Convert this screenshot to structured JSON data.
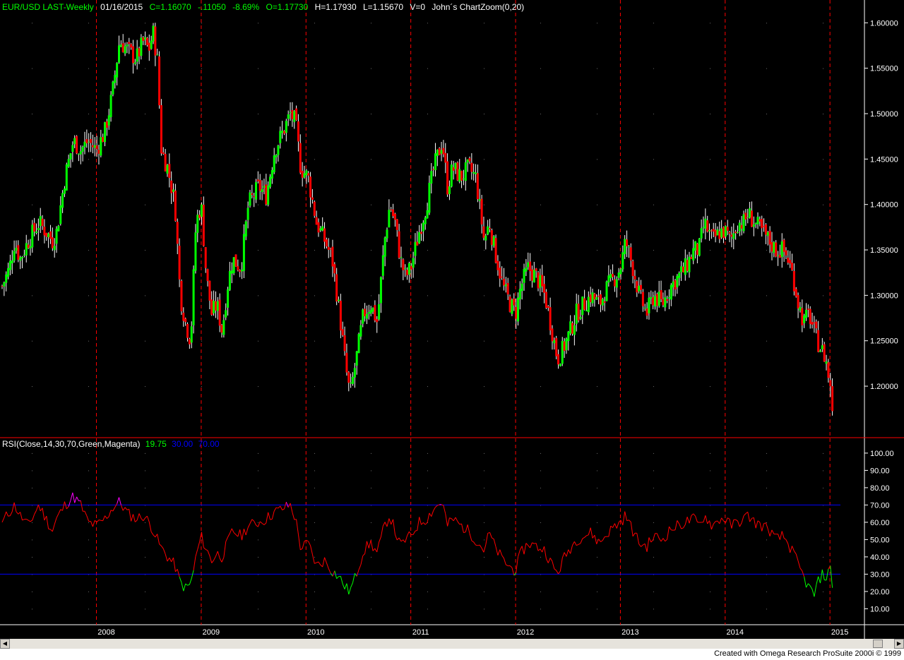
{
  "header": {
    "symbol": "EUR/USD LAST-Weekly",
    "date": "01/16/2015",
    "close": "C=1.16070",
    "change": "-.11050",
    "pct": "-8.69%",
    "open": "O=1.17730",
    "high": "H=1.17930",
    "low": "L=1.15670",
    "volume": "V=0",
    "study": "John´s ChartZoom(0,20)"
  },
  "rsi_header": {
    "label": "RSI(Close,14,30,70,Green,Magenta)",
    "value": "19.75",
    "low": "30.00",
    "high": "70.00"
  },
  "footer": {
    "text": "Created with Omega Research ProSuite 2000i © 1999"
  },
  "colors": {
    "up": "#00ff00",
    "down": "#ff0000",
    "text_green": "#00ff00",
    "text_white": "#ffffff",
    "rsi_blue": "#0000ff",
    "separator": "#ff0000",
    "rsi_normal": "#ff0000",
    "rsi_oversold": "#00ff00",
    "rsi_overbought": "#ff00ff"
  },
  "chart_data": [
    {
      "type": "candlestick",
      "title": "EUR/USD LAST-Weekly",
      "x_labels": [
        "2008",
        "2009",
        "2010",
        "2011",
        "2012",
        "2013",
        "2014",
        "2015"
      ],
      "x_label_dates": [
        2008.0,
        2009.0,
        2010.0,
        2011.0,
        2012.0,
        2013.0,
        2014.0,
        2015.0
      ],
      "x_range": [
        2007.1,
        2015.1
      ],
      "y_ticks": [
        "1.60000",
        "1.55000",
        "1.50000",
        "1.45000",
        "1.40000",
        "1.35000",
        "1.30000",
        "1.25000",
        "1.20000"
      ],
      "ylim": [
        1.148,
        1.608
      ],
      "close_path": [
        [
          2007.1,
          1.31
        ],
        [
          2007.17,
          1.33
        ],
        [
          2007.22,
          1.36
        ],
        [
          2007.27,
          1.34
        ],
        [
          2007.35,
          1.36
        ],
        [
          2007.45,
          1.38
        ],
        [
          2007.52,
          1.37
        ],
        [
          2007.58,
          1.36
        ],
        [
          2007.62,
          1.37
        ],
        [
          2007.7,
          1.43
        ],
        [
          2007.78,
          1.47
        ],
        [
          2007.85,
          1.46
        ],
        [
          2007.92,
          1.47
        ],
        [
          2008.0,
          1.46
        ],
        [
          2008.08,
          1.48
        ],
        [
          2008.15,
          1.52
        ],
        [
          2008.22,
          1.58
        ],
        [
          2008.3,
          1.57
        ],
        [
          2008.38,
          1.56
        ],
        [
          2008.45,
          1.58
        ],
        [
          2008.5,
          1.57
        ],
        [
          2008.54,
          1.59
        ],
        [
          2008.58,
          1.56
        ],
        [
          2008.62,
          1.46
        ],
        [
          2008.68,
          1.44
        ],
        [
          2008.75,
          1.4
        ],
        [
          2008.8,
          1.3
        ],
        [
          2008.85,
          1.27
        ],
        [
          2008.9,
          1.25
        ],
        [
          2008.95,
          1.38
        ],
        [
          2009.0,
          1.4
        ],
        [
          2009.05,
          1.32
        ],
        [
          2009.1,
          1.28
        ],
        [
          2009.15,
          1.29
        ],
        [
          2009.2,
          1.26
        ],
        [
          2009.25,
          1.31
        ],
        [
          2009.3,
          1.34
        ],
        [
          2009.38,
          1.33
        ],
        [
          2009.45,
          1.4
        ],
        [
          2009.55,
          1.42
        ],
        [
          2009.62,
          1.41
        ],
        [
          2009.7,
          1.46
        ],
        [
          2009.78,
          1.48
        ],
        [
          2009.85,
          1.5
        ],
        [
          2009.9,
          1.49
        ],
        [
          2009.95,
          1.44
        ],
        [
          2010.02,
          1.43
        ],
        [
          2010.1,
          1.38
        ],
        [
          2010.18,
          1.36
        ],
        [
          2010.25,
          1.34
        ],
        [
          2010.32,
          1.28
        ],
        [
          2010.38,
          1.22
        ],
        [
          2010.42,
          1.19
        ],
        [
          2010.48,
          1.23
        ],
        [
          2010.55,
          1.28
        ],
        [
          2010.62,
          1.29
        ],
        [
          2010.68,
          1.27
        ],
        [
          2010.75,
          1.36
        ],
        [
          2010.8,
          1.4
        ],
        [
          2010.85,
          1.38
        ],
        [
          2010.9,
          1.34
        ],
        [
          2010.95,
          1.32
        ],
        [
          2011.0,
          1.33
        ],
        [
          2011.08,
          1.37
        ],
        [
          2011.15,
          1.4
        ],
        [
          2011.22,
          1.44
        ],
        [
          2011.3,
          1.47
        ],
        [
          2011.35,
          1.42
        ],
        [
          2011.4,
          1.44
        ],
        [
          2011.48,
          1.43
        ],
        [
          2011.55,
          1.44
        ],
        [
          2011.62,
          1.43
        ],
        [
          2011.7,
          1.36
        ],
        [
          2011.75,
          1.38
        ],
        [
          2011.8,
          1.35
        ],
        [
          2011.88,
          1.31
        ],
        [
          2011.95,
          1.29
        ],
        [
          2012.0,
          1.28
        ],
        [
          2012.05,
          1.31
        ],
        [
          2012.12,
          1.33
        ],
        [
          2012.2,
          1.32
        ],
        [
          2012.28,
          1.3
        ],
        [
          2012.35,
          1.26
        ],
        [
          2012.4,
          1.23
        ],
        [
          2012.45,
          1.24
        ],
        [
          2012.52,
          1.26
        ],
        [
          2012.58,
          1.28
        ],
        [
          2012.65,
          1.29
        ],
        [
          2012.72,
          1.3
        ],
        [
          2012.8,
          1.29
        ],
        [
          2012.88,
          1.31
        ],
        [
          2012.95,
          1.32
        ],
        [
          2013.0,
          1.33
        ],
        [
          2013.05,
          1.36
        ],
        [
          2013.12,
          1.33
        ],
        [
          2013.18,
          1.3
        ],
        [
          2013.25,
          1.28
        ],
        [
          2013.32,
          1.3
        ],
        [
          2013.4,
          1.29
        ],
        [
          2013.48,
          1.31
        ],
        [
          2013.55,
          1.32
        ],
        [
          2013.62,
          1.33
        ],
        [
          2013.7,
          1.35
        ],
        [
          2013.75,
          1.35
        ],
        [
          2013.8,
          1.38
        ],
        [
          2013.88,
          1.36
        ],
        [
          2013.95,
          1.37
        ],
        [
          2014.0,
          1.37
        ],
        [
          2014.05,
          1.36
        ],
        [
          2014.12,
          1.38
        ],
        [
          2014.18,
          1.38
        ],
        [
          2014.22,
          1.39
        ],
        [
          2014.28,
          1.38
        ],
        [
          2014.35,
          1.37
        ],
        [
          2014.42,
          1.36
        ],
        [
          2014.48,
          1.35
        ],
        [
          2014.55,
          1.35
        ],
        [
          2014.6,
          1.34
        ],
        [
          2014.65,
          1.32
        ],
        [
          2014.7,
          1.29
        ],
        [
          2014.75,
          1.27
        ],
        [
          2014.8,
          1.28
        ],
        [
          2014.85,
          1.26
        ],
        [
          2014.88,
          1.25
        ],
        [
          2014.92,
          1.24
        ],
        [
          2014.96,
          1.23
        ],
        [
          2015.0,
          1.2
        ],
        [
          2015.02,
          1.18
        ],
        [
          2015.04,
          1.16
        ]
      ]
    },
    {
      "type": "line",
      "title": "RSI(Close,14,30,70,Green,Magenta)",
      "y_ticks": [
        "100.00",
        "90.00",
        "80.00",
        "70.00",
        "60.00",
        "50.00",
        "40.00",
        "30.00",
        "20.00",
        "10.00"
      ],
      "ylim": [
        2,
        102
      ],
      "overbought": 70,
      "oversold": 30,
      "x_range": [
        2007.1,
        2015.1
      ],
      "values": [
        [
          2007.1,
          60
        ],
        [
          2007.17,
          66
        ],
        [
          2007.22,
          70
        ],
        [
          2007.27,
          64
        ],
        [
          2007.35,
          58
        ],
        [
          2007.45,
          70
        ],
        [
          2007.52,
          62
        ],
        [
          2007.58,
          55
        ],
        [
          2007.62,
          62
        ],
        [
          2007.7,
          70
        ],
        [
          2007.78,
          75
        ],
        [
          2007.85,
          70
        ],
        [
          2007.92,
          60
        ],
        [
          2008.0,
          58
        ],
        [
          2008.08,
          62
        ],
        [
          2008.15,
          68
        ],
        [
          2008.22,
          72
        ],
        [
          2008.3,
          65
        ],
        [
          2008.38,
          62
        ],
        [
          2008.45,
          64
        ],
        [
          2008.5,
          60
        ],
        [
          2008.54,
          56
        ],
        [
          2008.58,
          50
        ],
        [
          2008.62,
          45
        ],
        [
          2008.68,
          40
        ],
        [
          2008.75,
          35
        ],
        [
          2008.8,
          25
        ],
        [
          2008.85,
          22
        ],
        [
          2008.9,
          24
        ],
        [
          2008.95,
          40
        ],
        [
          2009.0,
          52
        ],
        [
          2009.05,
          44
        ],
        [
          2009.1,
          38
        ],
        [
          2009.15,
          42
        ],
        [
          2009.2,
          40
        ],
        [
          2009.25,
          48
        ],
        [
          2009.3,
          55
        ],
        [
          2009.38,
          52
        ],
        [
          2009.45,
          58
        ],
        [
          2009.55,
          60
        ],
        [
          2009.62,
          62
        ],
        [
          2009.7,
          66
        ],
        [
          2009.78,
          68
        ],
        [
          2009.85,
          70
        ],
        [
          2009.9,
          62
        ],
        [
          2009.95,
          45
        ],
        [
          2010.02,
          48
        ],
        [
          2010.1,
          35
        ],
        [
          2010.18,
          38
        ],
        [
          2010.25,
          32
        ],
        [
          2010.32,
          28
        ],
        [
          2010.38,
          22
        ],
        [
          2010.42,
          20
        ],
        [
          2010.48,
          30
        ],
        [
          2010.55,
          44
        ],
        [
          2010.62,
          48
        ],
        [
          2010.68,
          42
        ],
        [
          2010.75,
          58
        ],
        [
          2010.8,
          64
        ],
        [
          2010.85,
          55
        ],
        [
          2010.9,
          46
        ],
        [
          2010.95,
          50
        ],
        [
          2011.0,
          52
        ],
        [
          2011.08,
          60
        ],
        [
          2011.15,
          62
        ],
        [
          2011.22,
          68
        ],
        [
          2011.3,
          72
        ],
        [
          2011.35,
          58
        ],
        [
          2011.4,
          62
        ],
        [
          2011.48,
          58
        ],
        [
          2011.55,
          55
        ],
        [
          2011.62,
          50
        ],
        [
          2011.7,
          44
        ],
        [
          2011.75,
          54
        ],
        [
          2011.8,
          46
        ],
        [
          2011.88,
          38
        ],
        [
          2011.95,
          34
        ],
        [
          2012.0,
          32
        ],
        [
          2012.05,
          42
        ],
        [
          2012.12,
          48
        ],
        [
          2012.2,
          46
        ],
        [
          2012.28,
          44
        ],
        [
          2012.35,
          35
        ],
        [
          2012.4,
          30
        ],
        [
          2012.45,
          38
        ],
        [
          2012.52,
          45
        ],
        [
          2012.58,
          50
        ],
        [
          2012.65,
          52
        ],
        [
          2012.72,
          54
        ],
        [
          2012.8,
          48
        ],
        [
          2012.88,
          54
        ],
        [
          2012.95,
          58
        ],
        [
          2013.0,
          60
        ],
        [
          2013.05,
          64
        ],
        [
          2013.12,
          55
        ],
        [
          2013.18,
          48
        ],
        [
          2013.25,
          46
        ],
        [
          2013.32,
          52
        ],
        [
          2013.4,
          50
        ],
        [
          2013.48,
          56
        ],
        [
          2013.55,
          58
        ],
        [
          2013.62,
          60
        ],
        [
          2013.7,
          62
        ],
        [
          2013.75,
          58
        ],
        [
          2013.8,
          64
        ],
        [
          2013.88,
          58
        ],
        [
          2013.95,
          62
        ],
        [
          2014.0,
          62
        ],
        [
          2014.05,
          58
        ],
        [
          2014.12,
          60
        ],
        [
          2014.18,
          62
        ],
        [
          2014.22,
          64
        ],
        [
          2014.28,
          60
        ],
        [
          2014.35,
          58
        ],
        [
          2014.42,
          56
        ],
        [
          2014.48,
          50
        ],
        [
          2014.55,
          52
        ],
        [
          2014.6,
          48
        ],
        [
          2014.65,
          42
        ],
        [
          2014.7,
          35
        ],
        [
          2014.75,
          28
        ],
        [
          2014.8,
          22
        ],
        [
          2014.85,
          18
        ],
        [
          2014.88,
          24
        ],
        [
          2014.92,
          30
        ],
        [
          2014.96,
          28
        ],
        [
          2015.0,
          34
        ],
        [
          2015.02,
          25
        ],
        [
          2015.04,
          20
        ]
      ]
    }
  ]
}
